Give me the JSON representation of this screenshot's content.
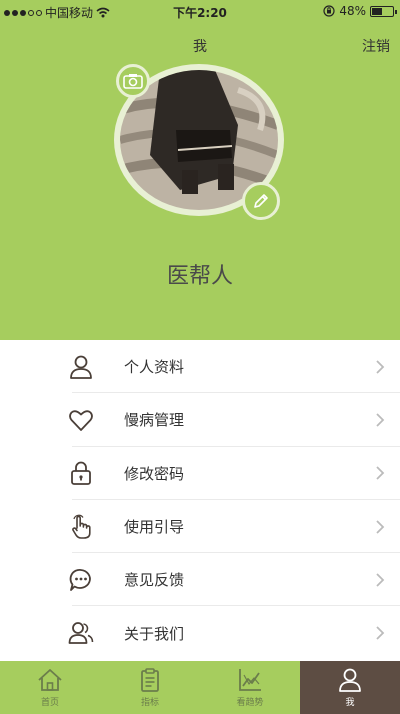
{
  "status_bar": {
    "carrier": "中国移动",
    "time": "下午2:20",
    "battery": "48%",
    "battery_level": 0.48
  },
  "nav": {
    "title": "我",
    "logout_label": "注销"
  },
  "profile": {
    "name": "医帮人"
  },
  "menu": [
    {
      "label": "个人资料",
      "icon": "person-icon"
    },
    {
      "label": "慢病管理",
      "icon": "heart-icon"
    },
    {
      "label": "修改密码",
      "icon": "lock-icon"
    },
    {
      "label": "使用引导",
      "icon": "hand-pointer-icon"
    },
    {
      "label": "意见反馈",
      "icon": "chat-bubble-icon"
    },
    {
      "label": "关于我们",
      "icon": "group-icon"
    }
  ],
  "tabbar": [
    {
      "label": "首页",
      "icon": "home-icon"
    },
    {
      "label": "指标",
      "icon": "clipboard-icon"
    },
    {
      "label": "看趋势",
      "icon": "trend-chart-icon"
    },
    {
      "label": "我",
      "icon": "user-icon",
      "active": true
    }
  ],
  "colors": {
    "header_green": "#a6cd5e",
    "tab_active": "#5d4d43",
    "icon_dark": "#4a3f38"
  }
}
